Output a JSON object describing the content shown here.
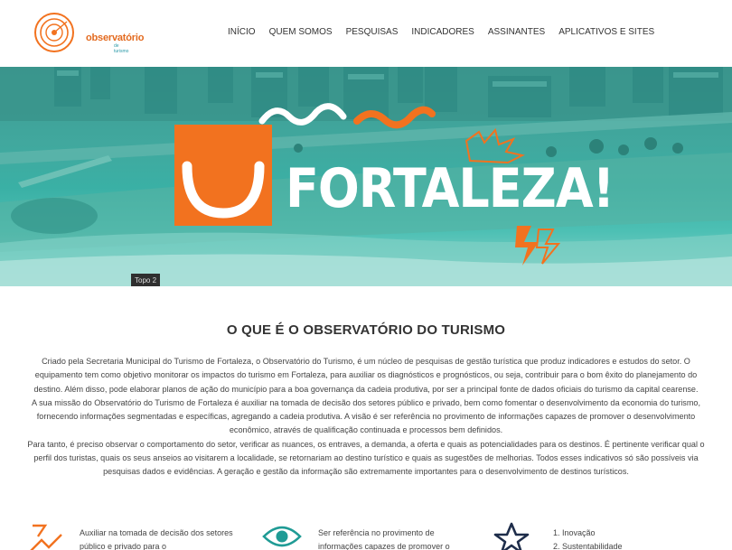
{
  "brand": {
    "name": "observatório",
    "sub": "de turismo",
    "primary_color": "#f2721f",
    "teal_color": "#2b9aa8"
  },
  "nav": {
    "items": [
      {
        "label": "INÍCIO"
      },
      {
        "label": "QUEM SOMOS"
      },
      {
        "label": "PESQUISAS"
      },
      {
        "label": "INDICADORES"
      },
      {
        "label": "ASSINANTES"
      },
      {
        "label": "APLICATIVOS E SITES"
      }
    ]
  },
  "hero": {
    "headline": "FORTALEZA!",
    "slide_label": "Topo 2"
  },
  "about": {
    "title": "O QUE É O OBSERVATÓRIO DO TURISMO",
    "paragraphs": [
      "Criado pela Secretaria Municipal do Turismo de Fortaleza, o Observatório do Turismo, é um núcleo de pesquisas de gestão turística que produz indicadores e estudos do setor. O equipamento tem como objetivo monitorar os impactos do turismo em Fortaleza, para auxiliar os diagnósticos e prognósticos, ou seja, contribuir para o bom êxito do planejamento do destino. Além disso, pode elaborar planos de ação do município para a boa governança da cadeia produtiva, por ser a principal fonte de dados oficiais do turismo da capital cearense.",
      "A sua missão do Observatório do Turismo de Fortaleza é auxiliar na tomada de decisão dos setores público e privado, bem como fomentar o desenvolvimento da economia do turismo, fornecendo informações segmentadas e específicas, agregando a cadeia produtiva. A visão é ser referência no provimento de informações capazes de promover o desenvolvimento econômico, através de qualificação continuada e processos bem definidos.",
      "Para tanto, é preciso observar o comportamento do setor, verificar as nuances, os entraves, a demanda, a oferta e quais as potencialidades para os destinos. É pertinente verificar qual o perfil dos turistas, quais os seus anseios ao visitarem a localidade, se retornariam ao destino turístico e quais as sugestões de melhorias. Todos esses indicativos só são possíveis via pesquisas dados e evidências. A geração e gestão da informação são extremamente importantes para o desenvolvimento de destinos turísticos."
    ]
  },
  "features": [
    {
      "icon": "growth-chart-icon",
      "text": "Auxiliar na tomada de decisão dos setores público e privado para o"
    },
    {
      "icon": "eye-icon",
      "text": "Ser referência no provimento de informações capazes de promover o"
    },
    {
      "icon": "star-icon",
      "lines": [
        "1. Inovação",
        "2. Sustentabilidade"
      ]
    }
  ]
}
